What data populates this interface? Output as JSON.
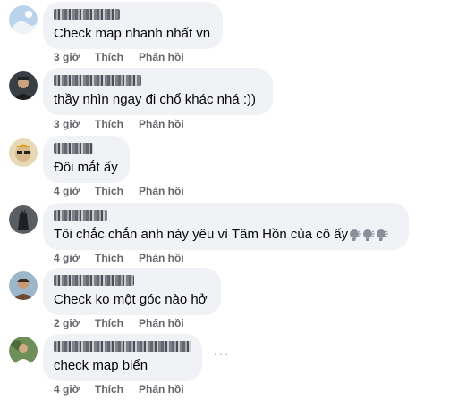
{
  "comments": [
    {
      "text": "Check map nhanh nhất vn",
      "time": "3 giờ",
      "like": "Thích",
      "reply": "Phản hồi",
      "avatar": "avatar-snow"
    },
    {
      "text": "thầy nhìn ngay đi chổ khác nhá :))",
      "time": "3 giờ",
      "like": "Thích",
      "reply": "Phản hồi",
      "avatar": "avatar-man"
    },
    {
      "text": "Đôi mắt ấy",
      "time": "4 giờ",
      "like": "Thích",
      "reply": "Phản hồi",
      "avatar": "avatar-face"
    },
    {
      "text": "Tôi chắc chắn anh này yêu vì Tâm Hồn của cô ấy",
      "time": "4 giờ",
      "like": "Thích",
      "reply": "Phản hồi",
      "avatar": "avatar-dark",
      "emoji": "speaking-head-emoji"
    },
    {
      "text": "Check ko một góc nào hở",
      "time": "2 giờ",
      "like": "Thích",
      "reply": "Phản hồi",
      "avatar": "avatar-portrait"
    },
    {
      "text": "check map biển",
      "time": "4 giờ",
      "like": "Thích",
      "reply": "Phản hồi",
      "avatar": "avatar-outdoor",
      "more": "···"
    }
  ]
}
